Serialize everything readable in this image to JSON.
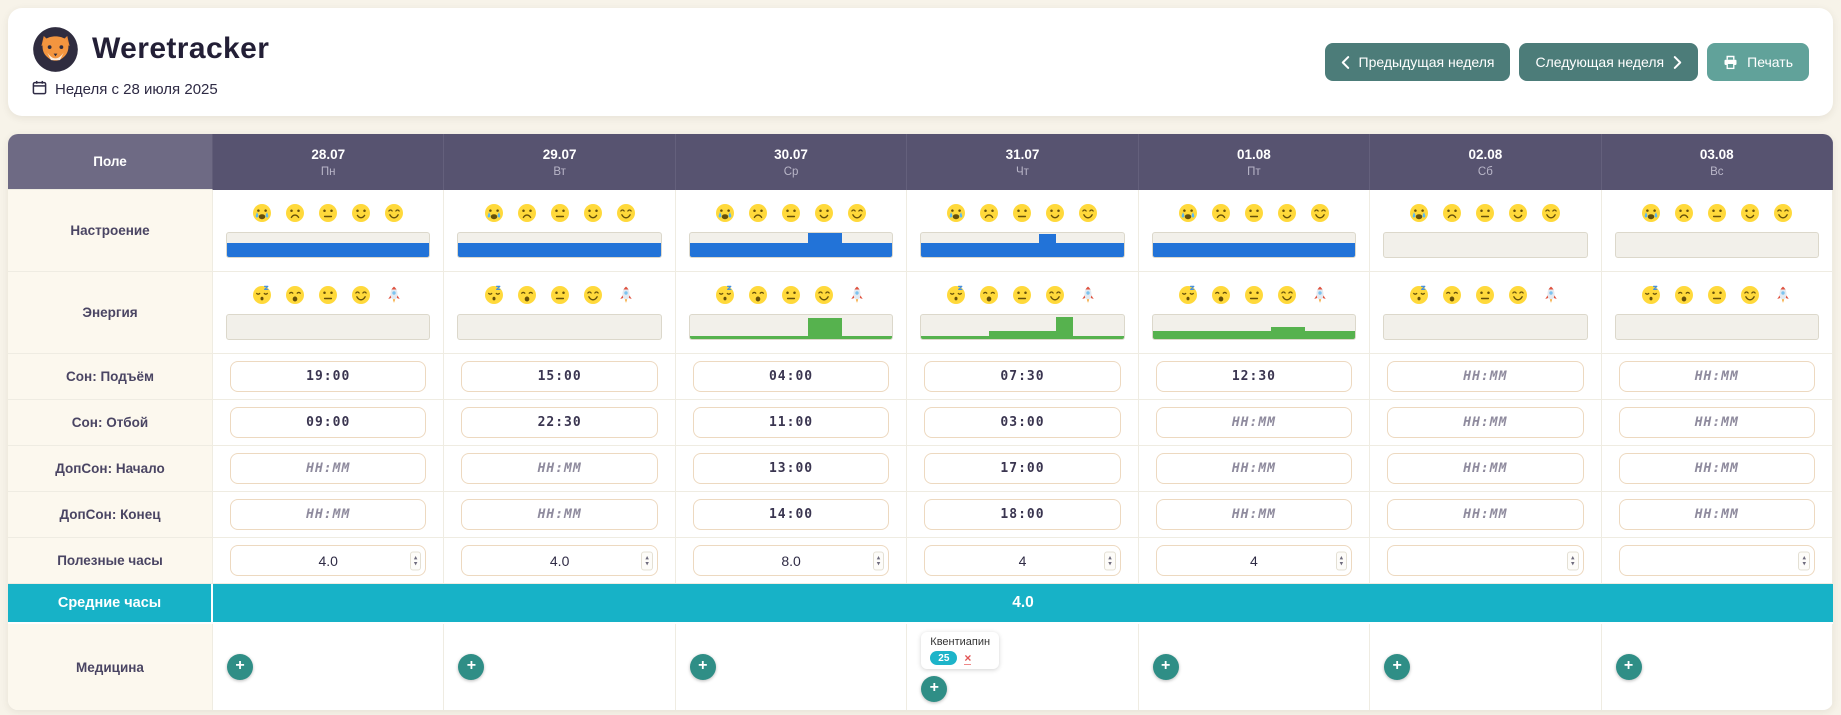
{
  "app": {
    "title": "Weretracker",
    "week_label": "Неделя с 28 июля 2025",
    "logo_icon": "werewolf-logo",
    "accent_teal": "#17b2c7",
    "header_purple": "#575370"
  },
  "toolbar": {
    "prev_week_label": "Предыдущая неделя",
    "next_week_label": "Следующая неделя",
    "print_label": "Печать"
  },
  "table": {
    "field_header": "Поле",
    "days": [
      {
        "date": "28.07",
        "weekday": "Пн"
      },
      {
        "date": "29.07",
        "weekday": "Вт"
      },
      {
        "date": "30.07",
        "weekday": "Ср"
      },
      {
        "date": "31.07",
        "weekday": "Чт"
      },
      {
        "date": "01.08",
        "weekday": "Пт"
      },
      {
        "date": "02.08",
        "weekday": "Сб"
      },
      {
        "date": "03.08",
        "weekday": "Вс"
      }
    ],
    "time_placeholder": "НН:ММ",
    "rows": {
      "mood": {
        "label": "Настроение",
        "scale_icons": [
          "crying-face",
          "sad-face",
          "neutral-face",
          "slight-smile-face",
          "happy-face"
        ],
        "bar_color": "#2273d8",
        "charts": [
          [
            60,
            60,
            60,
            60,
            60,
            60,
            60,
            60,
            60,
            60,
            60,
            60
          ],
          [
            60,
            60,
            60,
            60,
            60,
            60,
            60,
            60,
            60,
            60,
            60,
            60
          ],
          [
            58,
            58,
            58,
            58,
            58,
            58,
            58,
            100,
            100,
            58,
            58,
            58
          ],
          [
            60,
            60,
            60,
            60,
            60,
            60,
            60,
            95,
            60,
            60,
            60,
            60
          ],
          [
            60,
            60,
            60,
            60,
            60,
            60,
            60,
            60,
            60,
            60,
            60,
            60
          ],
          [],
          []
        ]
      },
      "energy": {
        "label": "Энергия",
        "scale_icons": [
          "sleeping-face",
          "weary-face",
          "neutral-face",
          "happy-face",
          "rocket"
        ],
        "bar_color": "#56b24e",
        "charts": [
          [],
          [],
          [
            13,
            13,
            13,
            13,
            13,
            13,
            13,
            88,
            88,
            13,
            13,
            13
          ],
          [
            14,
            14,
            14,
            14,
            32,
            32,
            32,
            32,
            90,
            14,
            14,
            14
          ],
          [
            34,
            34,
            34,
            34,
            34,
            34,
            34,
            52,
            52,
            34,
            34,
            34
          ],
          [],
          []
        ]
      },
      "sleep_wake": {
        "label": "Сон: Подъём",
        "values": [
          "19:00",
          "15:00",
          "04:00",
          "07:30",
          "12:30",
          "",
          ""
        ]
      },
      "sleep_bed": {
        "label": "Сон: Отбой",
        "values": [
          "09:00",
          "22:30",
          "11:00",
          "03:00",
          "",
          "",
          ""
        ]
      },
      "nap_start": {
        "label": "ДопСон: Начало",
        "values": [
          "",
          "",
          "13:00",
          "17:00",
          "",
          "",
          ""
        ]
      },
      "nap_end": {
        "label": "ДопСон: Конец",
        "values": [
          "",
          "",
          "14:00",
          "18:00",
          "",
          "",
          ""
        ]
      },
      "useful_hours": {
        "label": "Полезные часы",
        "values": [
          "4.0",
          "4.0",
          "8.0",
          "4",
          "4",
          "",
          ""
        ]
      },
      "average_hours": {
        "label": "Средние часы",
        "value": "4.0"
      },
      "medicine": {
        "label": "Медицина",
        "add_button": "+",
        "entries": [
          [],
          [],
          [],
          [
            {
              "name": "Квентиапин",
              "dose": "25",
              "remove": "×"
            }
          ],
          [],
          [],
          []
        ]
      }
    }
  }
}
